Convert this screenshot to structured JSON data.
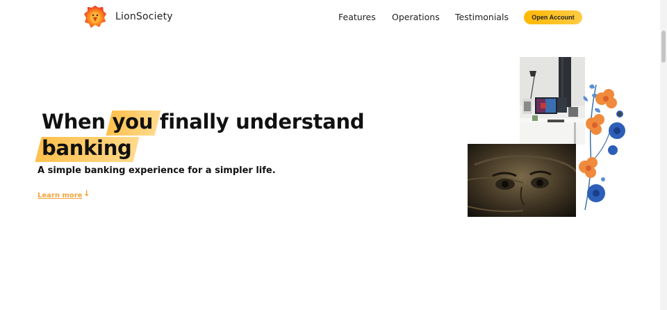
{
  "nav": {
    "brand": "LionSociety",
    "links": [
      "Features",
      "Operations",
      "Testimonials"
    ],
    "cta_label": "Open Account"
  },
  "hero": {
    "title_prefix": "When ",
    "title_highlight_1": "you",
    "title_middle": " finally understand",
    "title_highlight_2": "banking",
    "subtitle": "A simple banking experience for a simpler life.",
    "learn_more": "Learn more",
    "learn_more_arrow": "↓"
  },
  "colors": {
    "accent": "#ffb703",
    "highlight": "#ffcb45",
    "link": "#f2a33a"
  },
  "icons": {
    "logo": "lion-logo-icon",
    "arrow": "arrow-down-icon"
  }
}
